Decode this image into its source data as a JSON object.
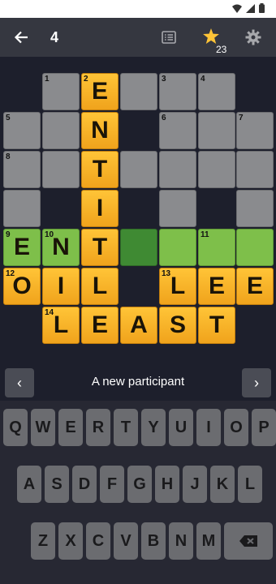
{
  "app_bar": {
    "puzzle_number": "4",
    "star_count": "23"
  },
  "colors": {
    "accent_star": "#ffc437",
    "solved_orange": "#f0a31c",
    "active_green": "#7ebf4a",
    "cursor_green": "#3f8a33"
  },
  "grid": {
    "cells": [
      {
        "r": 0,
        "c": 1,
        "s": "empty",
        "n": "1",
        "l": ""
      },
      {
        "r": 0,
        "c": 2,
        "s": "orange",
        "n": "2",
        "l": "E"
      },
      {
        "r": 0,
        "c": 3,
        "s": "empty",
        "n": "",
        "l": ""
      },
      {
        "r": 0,
        "c": 4,
        "s": "empty",
        "n": "3",
        "l": ""
      },
      {
        "r": 0,
        "c": 5,
        "s": "empty",
        "n": "4",
        "l": ""
      },
      {
        "r": 1,
        "c": 0,
        "s": "empty",
        "n": "5",
        "l": ""
      },
      {
        "r": 1,
        "c": 1,
        "s": "empty",
        "n": "",
        "l": ""
      },
      {
        "r": 1,
        "c": 2,
        "s": "orange",
        "n": "",
        "l": "N"
      },
      {
        "r": 1,
        "c": 4,
        "s": "empty",
        "n": "6",
        "l": ""
      },
      {
        "r": 1,
        "c": 5,
        "s": "empty",
        "n": "",
        "l": ""
      },
      {
        "r": 1,
        "c": 6,
        "s": "empty",
        "n": "7",
        "l": ""
      },
      {
        "r": 2,
        "c": 0,
        "s": "empty",
        "n": "8",
        "l": ""
      },
      {
        "r": 2,
        "c": 1,
        "s": "empty",
        "n": "",
        "l": ""
      },
      {
        "r": 2,
        "c": 2,
        "s": "orange",
        "n": "",
        "l": "T"
      },
      {
        "r": 2,
        "c": 3,
        "s": "empty",
        "n": "",
        "l": ""
      },
      {
        "r": 2,
        "c": 4,
        "s": "empty",
        "n": "",
        "l": ""
      },
      {
        "r": 2,
        "c": 5,
        "s": "empty",
        "n": "",
        "l": ""
      },
      {
        "r": 2,
        "c": 6,
        "s": "empty",
        "n": "",
        "l": ""
      },
      {
        "r": 3,
        "c": 0,
        "s": "empty",
        "n": "",
        "l": ""
      },
      {
        "r": 3,
        "c": 2,
        "s": "orange",
        "n": "",
        "l": "I"
      },
      {
        "r": 3,
        "c": 4,
        "s": "empty",
        "n": "",
        "l": ""
      },
      {
        "r": 3,
        "c": 6,
        "s": "empty",
        "n": "",
        "l": ""
      },
      {
        "r": 4,
        "c": 0,
        "s": "lgreen",
        "n": "9",
        "l": "E"
      },
      {
        "r": 4,
        "c": 1,
        "s": "lgreen",
        "n": "10",
        "l": "N"
      },
      {
        "r": 4,
        "c": 2,
        "s": "orange",
        "n": "",
        "l": "T"
      },
      {
        "r": 4,
        "c": 3,
        "s": "dgreen",
        "n": "",
        "l": ""
      },
      {
        "r": 4,
        "c": 4,
        "s": "lgreen",
        "n": "",
        "l": ""
      },
      {
        "r": 4,
        "c": 5,
        "s": "lgreen",
        "n": "11",
        "l": ""
      },
      {
        "r": 4,
        "c": 6,
        "s": "lgreen",
        "n": "",
        "l": ""
      },
      {
        "r": 5,
        "c": 0,
        "s": "orange",
        "n": "12",
        "l": "O"
      },
      {
        "r": 5,
        "c": 1,
        "s": "orange",
        "n": "",
        "l": "I"
      },
      {
        "r": 5,
        "c": 2,
        "s": "orange",
        "n": "",
        "l": "L"
      },
      {
        "r": 5,
        "c": 4,
        "s": "orange",
        "n": "13",
        "l": "L"
      },
      {
        "r": 5,
        "c": 5,
        "s": "orange",
        "n": "",
        "l": "E"
      },
      {
        "r": 5,
        "c": 6,
        "s": "orange",
        "n": "",
        "l": "E"
      },
      {
        "r": 6,
        "c": 1,
        "s": "orange",
        "n": "14",
        "l": "L"
      },
      {
        "r": 6,
        "c": 2,
        "s": "orange",
        "n": "",
        "l": "E"
      },
      {
        "r": 6,
        "c": 3,
        "s": "orange",
        "n": "",
        "l": "A"
      },
      {
        "r": 6,
        "c": 4,
        "s": "orange",
        "n": "",
        "l": "S"
      },
      {
        "r": 6,
        "c": 5,
        "s": "orange",
        "n": "",
        "l": "T"
      }
    ]
  },
  "clue": {
    "text": "A new participant",
    "prev_label": "‹",
    "next_label": "›"
  },
  "keyboard": {
    "rows": [
      [
        "Q",
        "W",
        "E",
        "R",
        "T",
        "Y",
        "U",
        "I",
        "O",
        "P"
      ],
      [
        "A",
        "S",
        "D",
        "F",
        "G",
        "H",
        "J",
        "K",
        "L"
      ],
      [
        "Z",
        "X",
        "C",
        "V",
        "B",
        "N",
        "M"
      ]
    ]
  }
}
